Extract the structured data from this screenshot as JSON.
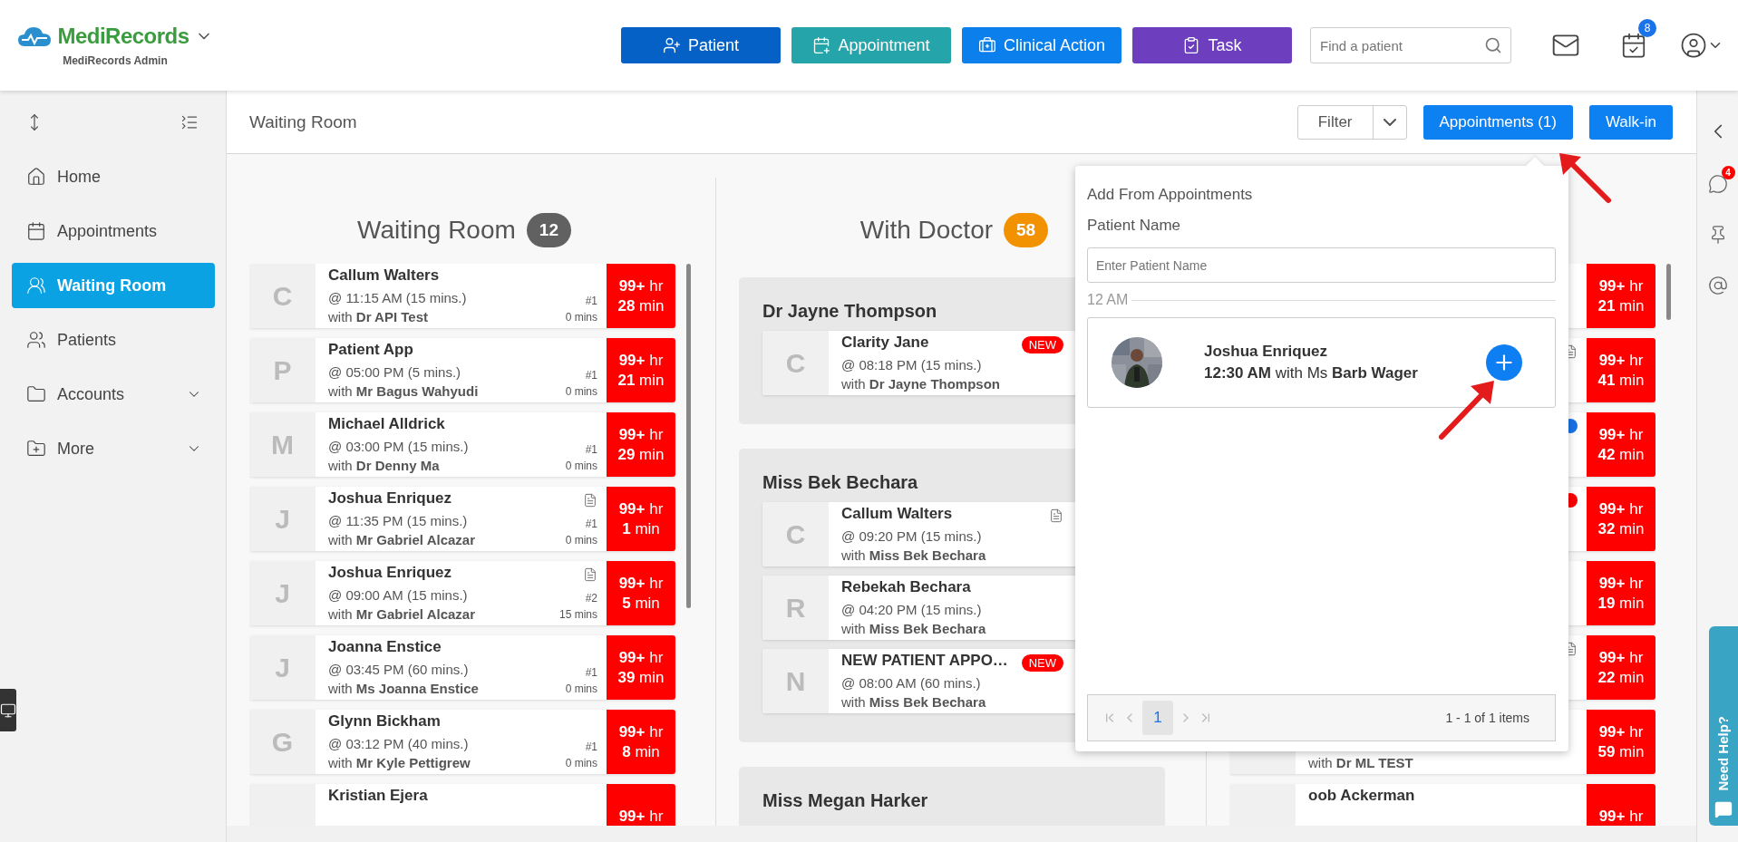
{
  "header": {
    "brand": "MediRecords",
    "subtitle": "MediRecords Admin",
    "actions": [
      {
        "label": "Patient",
        "kind": "patient",
        "color": "#0561c6"
      },
      {
        "label": "Appointment",
        "kind": "appointment",
        "color": "#25a5a9"
      },
      {
        "label": "Clinical Action",
        "kind": "clinical",
        "color": "#0b7fec"
      },
      {
        "label": "Task",
        "kind": "task",
        "color": "#6d3fbf"
      }
    ],
    "search": {
      "placeholder": "Find a patient"
    },
    "calendar_badge": "8"
  },
  "sidebar": {
    "items": [
      {
        "label": "Home",
        "kind": "home",
        "selected": false,
        "expandable": false
      },
      {
        "label": "Appointments",
        "kind": "appointments",
        "selected": false,
        "expandable": false
      },
      {
        "label": "Waiting Room",
        "kind": "waiting",
        "selected": true,
        "expandable": false
      },
      {
        "label": "Patients",
        "kind": "patients",
        "selected": false,
        "expandable": false
      },
      {
        "label": "Accounts",
        "kind": "accounts",
        "selected": false,
        "expandable": true
      },
      {
        "label": "More",
        "kind": "more",
        "selected": false,
        "expandable": true
      }
    ]
  },
  "toolbar": {
    "title": "Waiting Room",
    "filter": "Filter",
    "buttons": [
      "Appointments (1)",
      "Walk-in"
    ]
  },
  "columns": [
    {
      "kind": "queue",
      "title": "Waiting Room",
      "count": "12",
      "color": "#616161",
      "cards": [
        {
          "initial": "C",
          "name": "Callum Walters",
          "time": "@ 11:15 AM (15 mins.)",
          "with": "with **Dr API Test**",
          "queue": "#1",
          "wait": "0 mins",
          "timer": [
            "**99+** hr",
            "**28** min"
          ]
        },
        {
          "initial": "P",
          "name": "Patient App",
          "time": "@ 05:00 PM (5 mins.)",
          "with": "with **Mr Bagus Wahyudi**",
          "queue": "#1",
          "wait": "0 mins",
          "timer": [
            "**99+** hr",
            "**21** min"
          ]
        },
        {
          "initial": "M",
          "name": "Michael Alldrick",
          "time": "@ 03:00 PM (15 mins.)",
          "with": "with **Dr Denny Ma**",
          "queue": "#1",
          "wait": "0 mins",
          "timer": [
            "**99+** hr",
            "**29** min"
          ]
        },
        {
          "initial": "J",
          "name": "Joshua Enriquez",
          "note": true,
          "time": "@ 11:35 PM (15 mins.)",
          "with": "with **Mr Gabriel Alcazar**",
          "queue": "#1",
          "wait": "0 mins",
          "timer": [
            "**99+** hr",
            "**1** min"
          ]
        },
        {
          "initial": "J",
          "name": "Joshua Enriquez",
          "note": true,
          "time": "@ 09:00 AM (15 mins.)",
          "with": "with **Mr Gabriel Alcazar**",
          "queue": "#2",
          "wait": "15 mins",
          "timer": [
            "**99+** hr",
            "**5** min"
          ]
        },
        {
          "initial": "J",
          "name": "Joanna Enstice",
          "time": "@ 03:45 PM (60 mins.)",
          "with": "with **Ms Joanna Enstice**",
          "queue": "#1",
          "wait": "0 mins",
          "timer": [
            "**99+** hr",
            "**39** min"
          ]
        },
        {
          "initial": "G",
          "name": "Glynn Bickham",
          "time": "@ 03:12 PM (40 mins.)",
          "with": "with **Mr Kyle Pettigrew**",
          "queue": "#1",
          "wait": "0 mins",
          "timer": [
            "**99+** hr",
            "**8** min"
          ]
        },
        {
          "name": "Kristian Ejera",
          "timer": [
            "**99+** hr"
          ]
        }
      ]
    },
    {
      "kind": "groups",
      "title": "With Doctor",
      "count": "58",
      "color": "#f39200",
      "groups": [
        {
          "doctor": "Dr Jayne Thompson",
          "cards": [
            {
              "initial": "C",
              "name": "Clarity Jane",
              "badge": "NEW",
              "time": "@ 08:18 PM (15 mins.)",
              "with": "with **Dr Jayne Thompson**"
            }
          ]
        },
        {
          "doctor": "Miss Bek Bechara",
          "cards": [
            {
              "initial": "C",
              "name": "Callum Walters",
              "note": true,
              "time": "@ 09:20 PM (15 mins.)",
              "with": "with **Miss Bek Bechara**"
            },
            {
              "initial": "R",
              "name": "Rebekah Bechara",
              "time": "@ 04:20 PM (15 mins.)",
              "with": "with **Miss Bek Bechara**"
            },
            {
              "initial": "N",
              "name": "NEW PATIENT APPO…",
              "badge": "NEW",
              "time": "@ 08:00 AM (60 mins.)",
              "with": "with **Miss Bek Bechara**"
            }
          ]
        },
        {
          "doctor": "Miss Megan Harker"
        }
      ]
    },
    {
      "kind": "queue",
      "cards": [
        {
          "timer": [
            "**99+** hr",
            "**21** min"
          ]
        },
        {
          "note": true,
          "timer": [
            "**99+** hr",
            "**41** min"
          ]
        },
        {
          "color": "#1a73e8",
          "timer": [
            "**99+** hr",
            "**42** min"
          ]
        },
        {
          "color": "#ff0000",
          "timer": [
            "**99+** hr",
            "**32** min"
          ]
        },
        {
          "timer": [
            "**99+** hr",
            "**19** min"
          ]
        },
        {
          "note": true,
          "timer": [
            "**99+** hr",
            "**22** min"
          ]
        },
        {
          "with": "with **Dr ML TEST**",
          "timer": [
            "**99+** hr",
            "**59** min"
          ]
        },
        {
          "name": "oob Ackerman",
          "timer": [
            "**99+** hr"
          ]
        }
      ]
    }
  ],
  "popup": {
    "title": "Add From Appointments",
    "label": "Patient Name",
    "placeholder": "Enter Patient Name",
    "section": "12 AM",
    "appointments": [
      {
        "name": "Joshua Enriquez",
        "detail": "**12:30 AM** with Ms **Barb Wager**",
        "kind": "picture"
      }
    ],
    "pages": [
      {
        "label": "1",
        "selected": true
      }
    ],
    "summary": "1 - 1 of 1 items"
  },
  "rail": {
    "chat_badge": "4",
    "help": "Need Help?"
  }
}
